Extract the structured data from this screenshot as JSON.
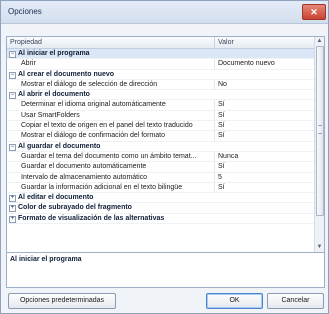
{
  "window": {
    "title": "Opciones",
    "close_glyph": "✕"
  },
  "grid": {
    "headers": {
      "property": "Propiedad",
      "value": "Valor"
    },
    "rows": [
      {
        "kind": "cat",
        "label": "Al iniciar el programa",
        "toggle": "−",
        "selected": true
      },
      {
        "kind": "item",
        "prop": "Abrir",
        "value": "Documento nuevo"
      },
      {
        "kind": "cat",
        "label": "Al crear el documento nuevo",
        "toggle": "−"
      },
      {
        "kind": "item",
        "prop": "Mostrar el diálogo de selección de dirección",
        "value": "No"
      },
      {
        "kind": "cat",
        "label": "Al abrir el documento",
        "toggle": "−"
      },
      {
        "kind": "item",
        "prop": "Determinar el idioma original automáticamente",
        "value": "Sí"
      },
      {
        "kind": "item",
        "prop": "Usar SmartFolders",
        "value": "Sí"
      },
      {
        "kind": "item",
        "prop": "Copiar el texto de origen en el panel del texto traducido",
        "value": "Sí"
      },
      {
        "kind": "item",
        "prop": "Mostrar el diálogo de confirmación del formato",
        "value": "Sí"
      },
      {
        "kind": "cat",
        "label": "Al guardar el documento",
        "toggle": "−"
      },
      {
        "kind": "item",
        "prop": "Guardar el tema del documento como un ámbito temat...",
        "value": "Nunca"
      },
      {
        "kind": "item",
        "prop": "Guardar el documento automáticamente",
        "value": "Sí"
      },
      {
        "kind": "item",
        "prop": "Intervalo de almacenamiento automático",
        "value": "5"
      },
      {
        "kind": "item",
        "prop": "Guardar la información adicional en el texto bilingüe",
        "value": "Sí"
      },
      {
        "kind": "cat",
        "label": "Al editar el documento",
        "toggle": "+"
      },
      {
        "kind": "cat",
        "label": "Color de subrayado del fragmento",
        "toggle": "+"
      },
      {
        "kind": "cat",
        "label": "Formato de visualización de las alternativas",
        "toggle": "+"
      }
    ]
  },
  "scrollbar": {
    "up_glyph": "▲",
    "down_glyph": "▼"
  },
  "description": {
    "title": "Al iniciar el programa"
  },
  "buttons": {
    "defaults": "Opciones predeterminadas",
    "ok": "OK",
    "cancel": "Cancelar"
  },
  "colors": {
    "accent": "#4a86d4",
    "title_text": "#1c2f4f",
    "close_button": "#c8442f"
  }
}
